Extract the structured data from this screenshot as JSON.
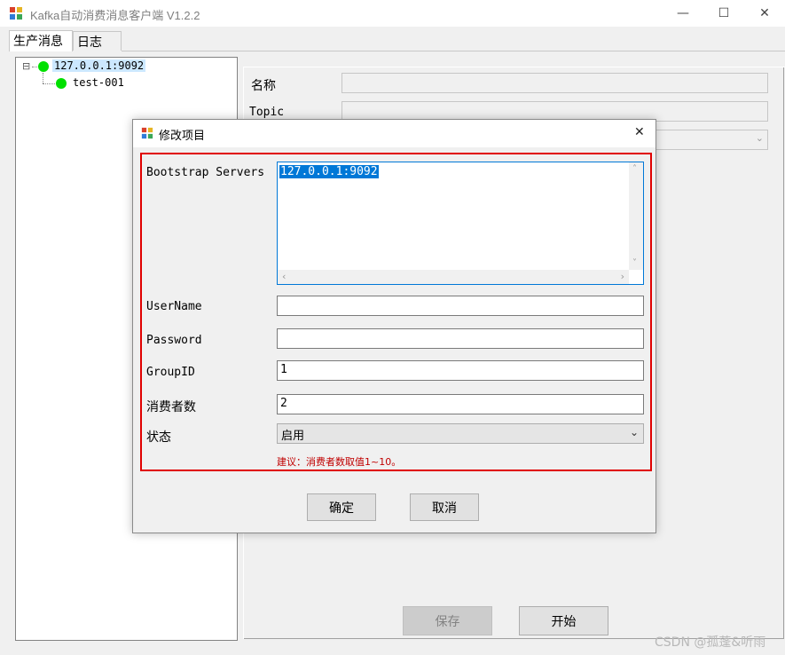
{
  "window": {
    "title": "Kafka自动消费消息客户端 V1.2.2",
    "minimize_glyph": "—",
    "maximize_glyph": "☐",
    "close_glyph": "✕"
  },
  "tabs": [
    {
      "label": "生产消息",
      "active": true
    },
    {
      "label": "日志",
      "active": false
    }
  ],
  "tree": {
    "expander": "⊟",
    "root": {
      "label": "127.0.0.1:9092",
      "selected": true,
      "status_color": "#00e000"
    },
    "children": [
      {
        "label": "test-001",
        "status_color": "#00e000"
      }
    ]
  },
  "right_panel": {
    "name_label": "名称",
    "topic_label": "Topic",
    "save_label": "保存",
    "start_label": "开始"
  },
  "dialog": {
    "title": "修改项目",
    "close_glyph": "✕",
    "fields": {
      "bootstrap_label": "Bootstrap Servers",
      "bootstrap_value": "127.0.0.1:9092",
      "username_label": "UserName",
      "username_value": "",
      "password_label": "Password",
      "password_value": "",
      "groupid_label": "GroupID",
      "groupid_value": "1",
      "consumers_label": "消费者数",
      "consumers_value": "2",
      "status_label": "状态",
      "status_value": "启用"
    },
    "hint": "建议：消费者数取值1~10。",
    "ok_label": "确定",
    "cancel_label": "取消"
  },
  "watermark": "CSDN @孤蓬&听雨",
  "colors": {
    "highlight": "#0078d7",
    "tree_selected": "#cce8ff",
    "accent_red": "#e00000",
    "status_green": "#00e000"
  }
}
